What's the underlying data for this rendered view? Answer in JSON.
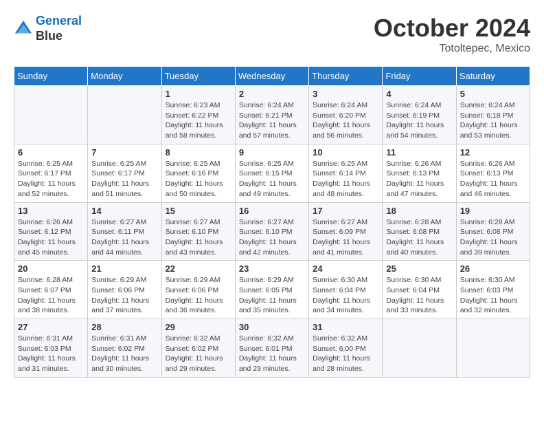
{
  "header": {
    "logo_line1": "General",
    "logo_line2": "Blue",
    "month": "October 2024",
    "location": "Totoltepec, Mexico"
  },
  "days_of_week": [
    "Sunday",
    "Monday",
    "Tuesday",
    "Wednesday",
    "Thursday",
    "Friday",
    "Saturday"
  ],
  "weeks": [
    [
      {
        "day": "",
        "detail": ""
      },
      {
        "day": "",
        "detail": ""
      },
      {
        "day": "1",
        "detail": "Sunrise: 6:23 AM\nSunset: 6:22 PM\nDaylight: 11 hours and 58 minutes."
      },
      {
        "day": "2",
        "detail": "Sunrise: 6:24 AM\nSunset: 6:21 PM\nDaylight: 11 hours and 57 minutes."
      },
      {
        "day": "3",
        "detail": "Sunrise: 6:24 AM\nSunset: 6:20 PM\nDaylight: 11 hours and 56 minutes."
      },
      {
        "day": "4",
        "detail": "Sunrise: 6:24 AM\nSunset: 6:19 PM\nDaylight: 11 hours and 54 minutes."
      },
      {
        "day": "5",
        "detail": "Sunrise: 6:24 AM\nSunset: 6:18 PM\nDaylight: 11 hours and 53 minutes."
      }
    ],
    [
      {
        "day": "6",
        "detail": "Sunrise: 6:25 AM\nSunset: 6:17 PM\nDaylight: 11 hours and 52 minutes."
      },
      {
        "day": "7",
        "detail": "Sunrise: 6:25 AM\nSunset: 6:17 PM\nDaylight: 11 hours and 51 minutes."
      },
      {
        "day": "8",
        "detail": "Sunrise: 6:25 AM\nSunset: 6:16 PM\nDaylight: 11 hours and 50 minutes."
      },
      {
        "day": "9",
        "detail": "Sunrise: 6:25 AM\nSunset: 6:15 PM\nDaylight: 11 hours and 49 minutes."
      },
      {
        "day": "10",
        "detail": "Sunrise: 6:25 AM\nSunset: 6:14 PM\nDaylight: 11 hours and 48 minutes."
      },
      {
        "day": "11",
        "detail": "Sunrise: 6:26 AM\nSunset: 6:13 PM\nDaylight: 11 hours and 47 minutes."
      },
      {
        "day": "12",
        "detail": "Sunrise: 6:26 AM\nSunset: 6:13 PM\nDaylight: 11 hours and 46 minutes."
      }
    ],
    [
      {
        "day": "13",
        "detail": "Sunrise: 6:26 AM\nSunset: 6:12 PM\nDaylight: 11 hours and 45 minutes."
      },
      {
        "day": "14",
        "detail": "Sunrise: 6:27 AM\nSunset: 6:11 PM\nDaylight: 11 hours and 44 minutes."
      },
      {
        "day": "15",
        "detail": "Sunrise: 6:27 AM\nSunset: 6:10 PM\nDaylight: 11 hours and 43 minutes."
      },
      {
        "day": "16",
        "detail": "Sunrise: 6:27 AM\nSunset: 6:10 PM\nDaylight: 11 hours and 42 minutes."
      },
      {
        "day": "17",
        "detail": "Sunrise: 6:27 AM\nSunset: 6:09 PM\nDaylight: 11 hours and 41 minutes."
      },
      {
        "day": "18",
        "detail": "Sunrise: 6:28 AM\nSunset: 6:08 PM\nDaylight: 11 hours and 40 minutes."
      },
      {
        "day": "19",
        "detail": "Sunrise: 6:28 AM\nSunset: 6:08 PM\nDaylight: 11 hours and 39 minutes."
      }
    ],
    [
      {
        "day": "20",
        "detail": "Sunrise: 6:28 AM\nSunset: 6:07 PM\nDaylight: 11 hours and 38 minutes."
      },
      {
        "day": "21",
        "detail": "Sunrise: 6:29 AM\nSunset: 6:06 PM\nDaylight: 11 hours and 37 minutes."
      },
      {
        "day": "22",
        "detail": "Sunrise: 6:29 AM\nSunset: 6:06 PM\nDaylight: 11 hours and 36 minutes."
      },
      {
        "day": "23",
        "detail": "Sunrise: 6:29 AM\nSunset: 6:05 PM\nDaylight: 11 hours and 35 minutes."
      },
      {
        "day": "24",
        "detail": "Sunrise: 6:30 AM\nSunset: 6:04 PM\nDaylight: 11 hours and 34 minutes."
      },
      {
        "day": "25",
        "detail": "Sunrise: 6:30 AM\nSunset: 6:04 PM\nDaylight: 11 hours and 33 minutes."
      },
      {
        "day": "26",
        "detail": "Sunrise: 6:30 AM\nSunset: 6:03 PM\nDaylight: 11 hours and 32 minutes."
      }
    ],
    [
      {
        "day": "27",
        "detail": "Sunrise: 6:31 AM\nSunset: 6:03 PM\nDaylight: 11 hours and 31 minutes."
      },
      {
        "day": "28",
        "detail": "Sunrise: 6:31 AM\nSunset: 6:02 PM\nDaylight: 11 hours and 30 minutes."
      },
      {
        "day": "29",
        "detail": "Sunrise: 6:32 AM\nSunset: 6:02 PM\nDaylight: 11 hours and 29 minutes."
      },
      {
        "day": "30",
        "detail": "Sunrise: 6:32 AM\nSunset: 6:01 PM\nDaylight: 11 hours and 29 minutes."
      },
      {
        "day": "31",
        "detail": "Sunrise: 6:32 AM\nSunset: 6:00 PM\nDaylight: 11 hours and 28 minutes."
      },
      {
        "day": "",
        "detail": ""
      },
      {
        "day": "",
        "detail": ""
      }
    ]
  ]
}
